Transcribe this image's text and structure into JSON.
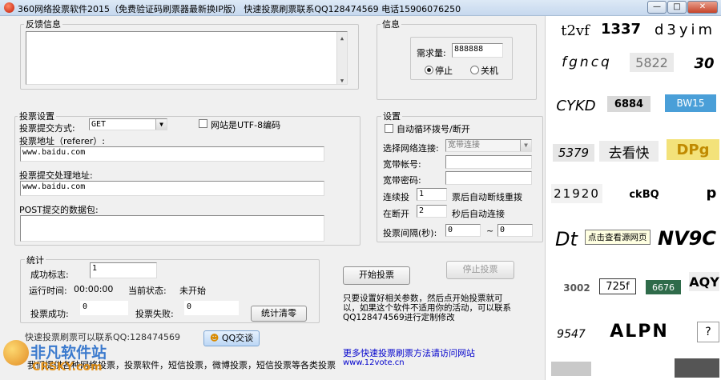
{
  "window": {
    "title": "360网络投票软件2015（免费验证码刷票器最新换IP版）     快速投票刷票联系QQ128474569 电话15906076250"
  },
  "feedback": {
    "legend": "反馈信息"
  },
  "info": {
    "legend": "信息",
    "demand_label": "需求量:",
    "demand_value": "888888",
    "stop_label": "停止",
    "shutdown_label": "关机"
  },
  "vote": {
    "legend": "投票设置",
    "method_label": "投票提交方式:",
    "method_value": "GET",
    "utf8_label": "网站是UTF-8编码",
    "url_label": "投票地址（referer）:",
    "url_value": "www.baidu.com",
    "process_label": "投票提交处理地址:",
    "process_value": "www.baidu.com",
    "post_label": "POST提交的数据包:"
  },
  "settings": {
    "legend": "设置",
    "auto_dial_label": "自动循环拨号/断开",
    "network_label": "选择网络连接:",
    "network_value": "宽带连接",
    "account_label": "宽带帐号:",
    "password_label": "宽带密码:",
    "consec_label": "连续投",
    "consec_value": "1",
    "consec_suffix": "票后自动断线重拨",
    "disconnect_label": "在断开",
    "disconnect_value": "2",
    "disconnect_suffix": "秒后自动连接",
    "interval_label": "投票间隔(秒):",
    "interval_from": "0",
    "interval_tilde": "~",
    "interval_to": "0"
  },
  "stats": {
    "legend": "统计",
    "success_flag_label": "成功标志:",
    "success_flag_value": "1",
    "runtime_label": "运行时间:",
    "runtime_value": "00:00:00",
    "state_label": "当前状态:",
    "state_value": "未开始",
    "success_label": "投票成功:",
    "success_value": "0",
    "fail_label": "投票失败:",
    "fail_value": "0",
    "clear_button": "统计清零"
  },
  "actions": {
    "start": "开始投票",
    "stop": "停止投票"
  },
  "help_text": "只要设置好相关参数，然后点开始投票就可以，如果这个软件不适用你的活动，可以联系QQ128474569进行定制修改",
  "contact": "快速投票刷票可以联系QQ:128474569",
  "qq_button": "QQ交谈",
  "footer": "我们提供各种网络投票，投票软件，短信投票，微博投票，短信投票等各类投票",
  "more_link": "更多快速投票刷票方法请访问网站",
  "site_url": "www.12vote.cn",
  "tooltip": "点击查看源网页",
  "watermark": {
    "brand": "非凡软件站",
    "domain": "CRSKY.com"
  },
  "captchas": [
    "t2vf",
    "1337",
    "d3yim",
    "fgncq",
    "5822",
    "30",
    "CYKD",
    "6884",
    "BW15",
    "5379",
    "去看快",
    "DPg",
    "21920",
    "ckBQ",
    "p",
    "Dt",
    "NV9C",
    "3002",
    "725f",
    "6676",
    "AQY",
    "9547",
    "ALPN",
    "?"
  ],
  "colors": {
    "link": "#0000cc",
    "title_icon": "#c21a05"
  }
}
